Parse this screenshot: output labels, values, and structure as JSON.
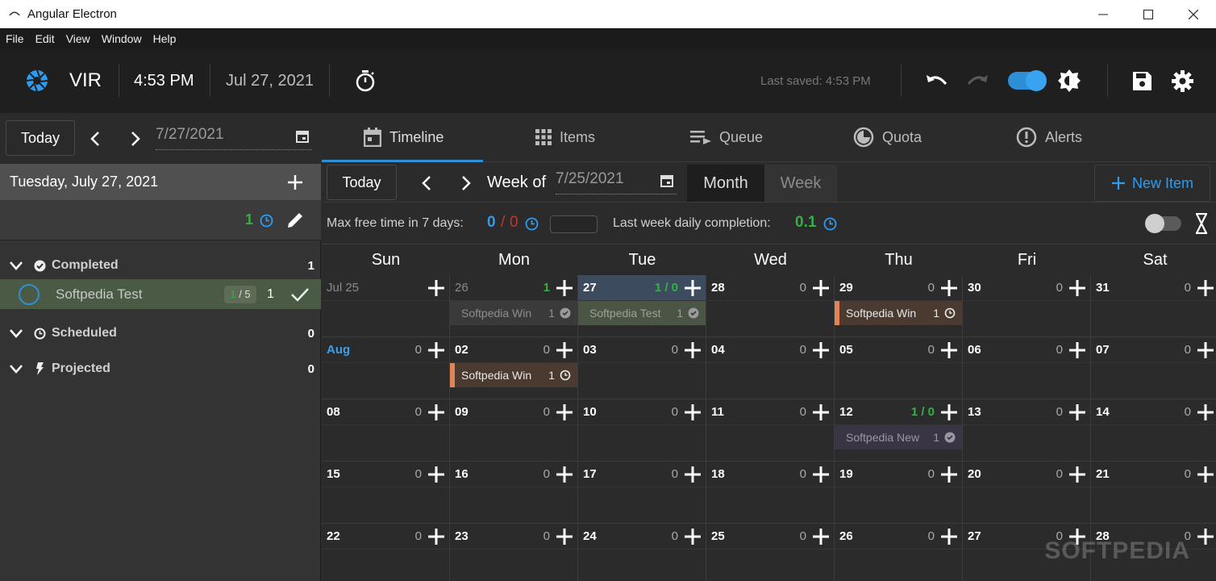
{
  "window": {
    "title": "Angular Electron",
    "min": "—",
    "max": "☐",
    "close": "✕"
  },
  "menu": [
    "File",
    "Edit",
    "View",
    "Window",
    "Help"
  ],
  "toolbar": {
    "brand": "VIR",
    "time": "4:53 PM",
    "date": "Jul 27, 2021",
    "last_saved": "Last saved: 4:53 PM",
    "accent": "#2e8fd6"
  },
  "sidebar": {
    "today_label": "Today",
    "date_value": "7/27/2021",
    "day_title": "Tuesday, July 27, 2021",
    "summary_count": "1",
    "sections": [
      {
        "label": "Completed",
        "count": "1",
        "icon": "check-circle-icon"
      },
      {
        "label": "Scheduled",
        "count": "0",
        "icon": "clock-icon"
      },
      {
        "label": "Projected",
        "count": "0",
        "icon": "bolt-icon"
      }
    ],
    "task": {
      "name": "Softpedia Test",
      "badge_done": "1",
      "badge_total": "/ 5",
      "count": "1"
    }
  },
  "tabs": [
    {
      "label": "Timeline",
      "icon": "calendar-icon"
    },
    {
      "label": "Items",
      "icon": "grid-icon"
    },
    {
      "label": "Queue",
      "icon": "queue-icon"
    },
    {
      "label": "Quota",
      "icon": "pie-icon"
    },
    {
      "label": "Alerts",
      "icon": "alert-icon"
    }
  ],
  "calendar_nav": {
    "today_label": "Today",
    "week_of_label": "Week of",
    "week_date": "7/25/2021",
    "view_month": "Month",
    "view_week": "Week",
    "new_item": "New Item"
  },
  "stats": {
    "max_free_label": "Max free time in 7 days:",
    "free_a": "0",
    "free_sep": "/",
    "free_b": "0",
    "last_week_label": "Last week daily completion:",
    "completion": "0.1"
  },
  "calendar": {
    "days_of_week": [
      "Sun",
      "Mon",
      "Tue",
      "Wed",
      "Thu",
      "Fri",
      "Sat"
    ],
    "weeks": [
      [
        {
          "d": "Jul 25",
          "c": "",
          "style": "muted"
        },
        {
          "d": "26",
          "c": "1",
          "style": "muted",
          "green": true,
          "evt": {
            "name": "Softpedia Win",
            "count": "1",
            "kind": "done"
          }
        },
        {
          "d": "27",
          "c": "1 / 0",
          "green": true,
          "today": true,
          "evt": {
            "name": "Softpedia Test",
            "count": "1",
            "kind": "done-green"
          }
        },
        {
          "d": "28",
          "c": "0"
        },
        {
          "d": "29",
          "c": "0",
          "evt": {
            "name": "Softpedia Win",
            "count": "1",
            "kind": "sched"
          }
        },
        {
          "d": "30",
          "c": "0"
        },
        {
          "d": "31",
          "c": "0"
        }
      ],
      [
        {
          "d": "Aug",
          "c": "0",
          "style": "accent"
        },
        {
          "d": "02",
          "c": "0",
          "evt": {
            "name": "Softpedia Win",
            "count": "1",
            "kind": "sched"
          }
        },
        {
          "d": "03",
          "c": "0"
        },
        {
          "d": "04",
          "c": "0"
        },
        {
          "d": "05",
          "c": "0"
        },
        {
          "d": "06",
          "c": "0"
        },
        {
          "d": "07",
          "c": "0"
        }
      ],
      [
        {
          "d": "08",
          "c": "0"
        },
        {
          "d": "09",
          "c": "0"
        },
        {
          "d": "10",
          "c": "0"
        },
        {
          "d": "11",
          "c": "0"
        },
        {
          "d": "12",
          "c": "1 / 0",
          "green": true,
          "evt": {
            "name": "Softpedia New",
            "count": "1",
            "kind": "purple"
          }
        },
        {
          "d": "13",
          "c": "0"
        },
        {
          "d": "14",
          "c": "0"
        }
      ],
      [
        {
          "d": "15",
          "c": "0"
        },
        {
          "d": "16",
          "c": "0"
        },
        {
          "d": "17",
          "c": "0"
        },
        {
          "d": "18",
          "c": "0"
        },
        {
          "d": "19",
          "c": "0"
        },
        {
          "d": "20",
          "c": "0"
        },
        {
          "d": "21",
          "c": "0"
        }
      ],
      [
        {
          "d": "22",
          "c": "0"
        },
        {
          "d": "23",
          "c": "0"
        },
        {
          "d": "24",
          "c": "0"
        },
        {
          "d": "25",
          "c": "0"
        },
        {
          "d": "26",
          "c": "0"
        },
        {
          "d": "27",
          "c": "0"
        },
        {
          "d": "28",
          "c": "0"
        }
      ]
    ]
  },
  "watermark": "SOFTPEDIA"
}
